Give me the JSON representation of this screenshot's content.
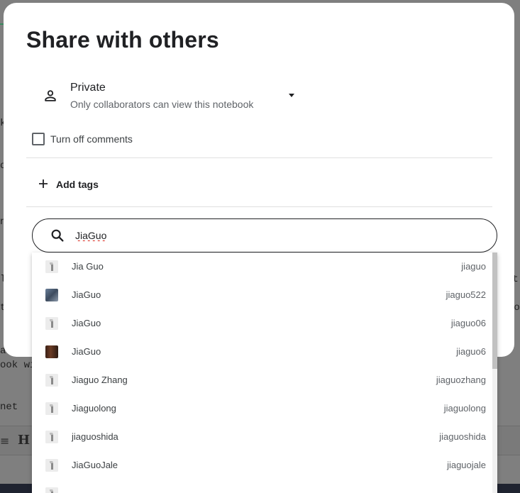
{
  "modal": {
    "title": "Share with others",
    "privacy": {
      "label": "Private",
      "description": "Only collaborators can view this notebook",
      "icon": "person-icon"
    },
    "comments_label": "Turn off comments",
    "comments_checked": false,
    "tags_label": "Add tags"
  },
  "search": {
    "value": "JiaGuo"
  },
  "results": [
    {
      "name": "Jia Guo",
      "handle": "jiaguo",
      "avatar": "default"
    },
    {
      "name": "JiaGuo",
      "handle": "jiaguo522",
      "avatar": "photo-a"
    },
    {
      "name": "JiaGuo",
      "handle": "jiaguo06",
      "avatar": "default"
    },
    {
      "name": "JiaGuo",
      "handle": "jiaguo6",
      "avatar": "photo-b"
    },
    {
      "name": "Jiaguo Zhang",
      "handle": "jiaguozhang",
      "avatar": "default"
    },
    {
      "name": "Jiaguolong",
      "handle": "jiaguolong",
      "avatar": "default"
    },
    {
      "name": "jiaguoshida",
      "handle": "jiaguoshida",
      "avatar": "default"
    },
    {
      "name": "JiaGuoJale",
      "handle": "jiaguojale",
      "avatar": "default"
    }
  ],
  "background": {
    "fragments": [
      "k",
      "o",
      "n",
      "l",
      "t",
      "a",
      "ook wi",
      "net",
      "it",
      "vo"
    ],
    "toolbar_icons": [
      "H"
    ]
  },
  "colors": {
    "overlay": "#7f7f7f",
    "modal_bg": "#ffffff",
    "text_primary": "#202124",
    "text_secondary": "#5f6368",
    "spell_underline": "#d93025"
  }
}
